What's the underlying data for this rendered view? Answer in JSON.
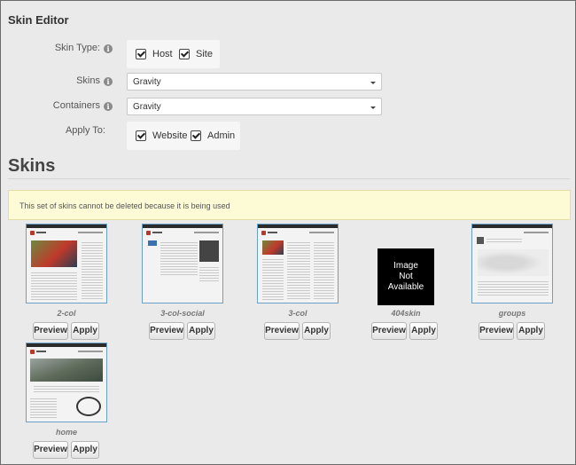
{
  "title": "Skin Editor",
  "fields": {
    "skin_type": {
      "label": "Skin Type:",
      "options": [
        {
          "label": "Host",
          "checked": true
        },
        {
          "label": "Site",
          "checked": true
        }
      ]
    },
    "skins": {
      "label": "Skins",
      "value": "Gravity"
    },
    "containers": {
      "label": "Containers",
      "value": "Gravity"
    },
    "apply_to": {
      "label": "Apply To:",
      "options": [
        {
          "label": "Website",
          "checked": true
        },
        {
          "label": "Admin",
          "checked": true
        }
      ]
    }
  },
  "info_icon": "info-icon",
  "section_heading": "Skins",
  "warning": "This set of skins cannot be deleted because it is being used",
  "no_image": {
    "line1": "Image",
    "line2": "Not",
    "line3": "Available"
  },
  "skin_items": [
    {
      "name": "2-col",
      "preview": "Preview",
      "apply": "Apply"
    },
    {
      "name": "3-col-social",
      "preview": "Preview",
      "apply": "Apply"
    },
    {
      "name": "3-col",
      "preview": "Preview",
      "apply": "Apply"
    },
    {
      "name": "404skin",
      "preview": "Preview",
      "apply": "Apply"
    },
    {
      "name": "groups",
      "preview": "Preview",
      "apply": "Apply"
    },
    {
      "name": "home",
      "preview": "Preview",
      "apply": "Apply"
    }
  ]
}
